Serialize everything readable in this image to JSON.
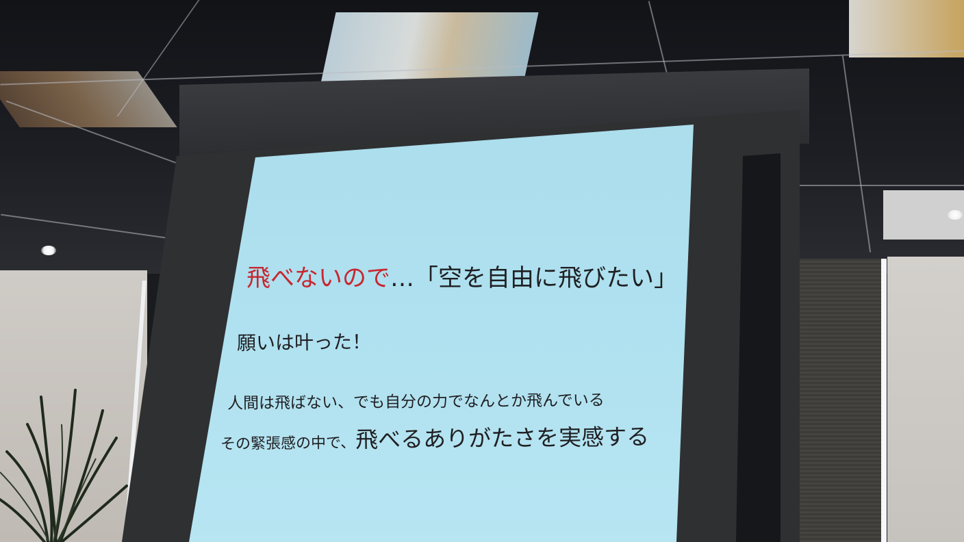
{
  "slide": {
    "headline_red": "飛べないので",
    "headline_dots": "…",
    "headline_quote": "「空を自由に飛びたい」",
    "wish_fulfilled": "願いは叶った！",
    "line1": "人間は飛ばない、でも自分の力でなんとか飛んでいる",
    "line2_small": "その緊張感の中で、",
    "line2_large": "飛べるありがたさを実感する"
  },
  "colors": {
    "slide_background": "#aee0ef",
    "headline_accent": "#c8262f",
    "slide_text": "#1f1f22"
  },
  "scene": {
    "icons": [
      "ceiling-light-icon",
      "plant-icon"
    ]
  }
}
